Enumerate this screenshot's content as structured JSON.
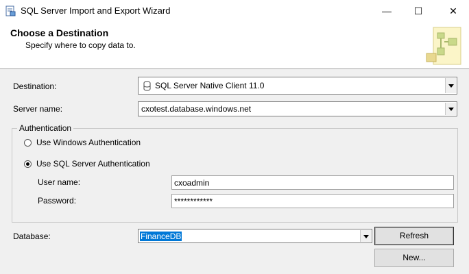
{
  "window": {
    "title": "SQL Server Import and Export Wizard",
    "icon": "wizard-app-icon",
    "minimize_glyph": "—",
    "maximize_glyph": "☐",
    "close_glyph": "✕"
  },
  "header": {
    "title": "Choose a Destination",
    "subtitle": "Specify where to copy data to."
  },
  "form": {
    "destination_label": "Destination:",
    "destination_value": "SQL Server Native Client 11.0",
    "server_label": "Server name:",
    "server_value": "cxotest.database.windows.net",
    "auth_group_label": "Authentication",
    "windows_auth_label": "Use Windows Authentication",
    "windows_auth_selected": false,
    "sql_auth_label": "Use SQL Server Authentication",
    "sql_auth_selected": true,
    "username_label": "User name:",
    "username_value": "cxoadmin",
    "password_label": "Password:",
    "password_value": "************",
    "database_label": "Database:",
    "database_value": "FinanceDB",
    "refresh_label": "Refresh",
    "new_label": "New..."
  }
}
